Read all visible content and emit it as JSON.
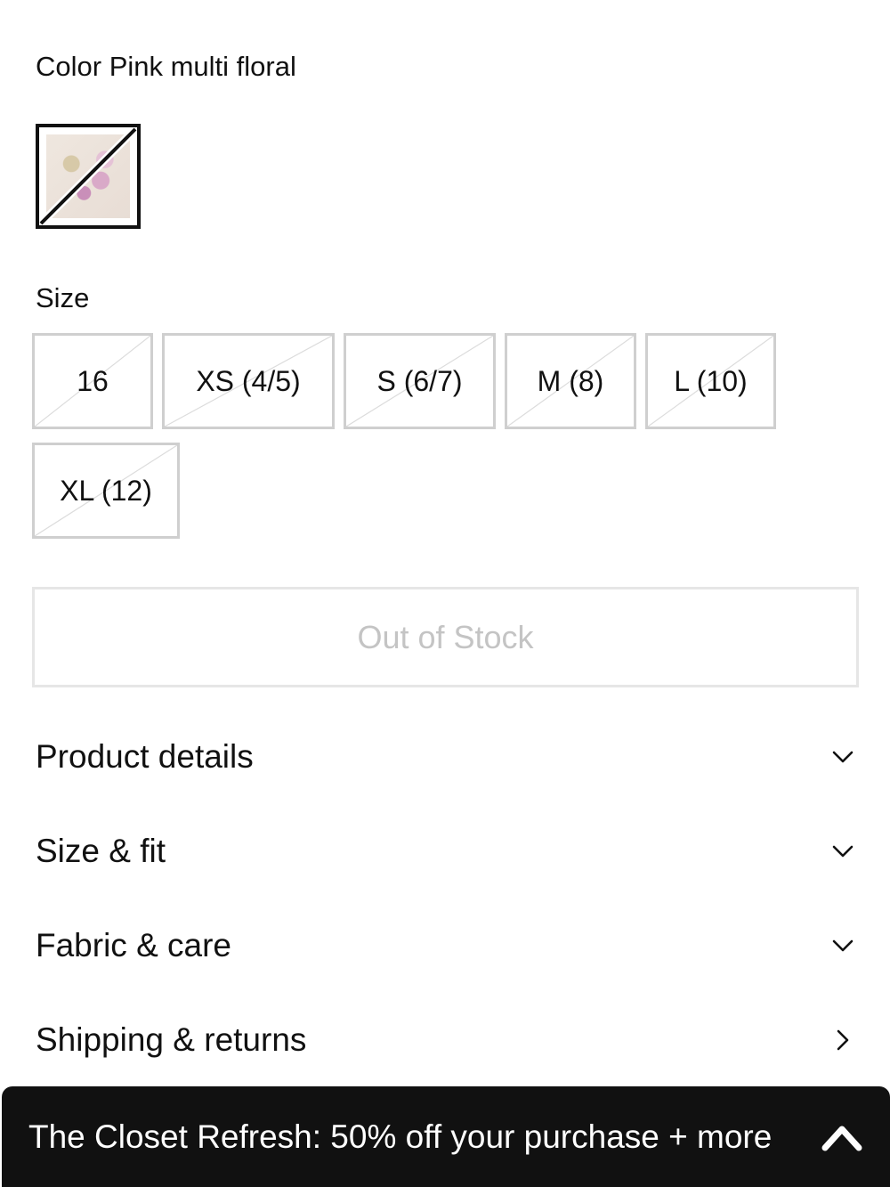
{
  "color": {
    "label": "Color Pink multi floral",
    "selected_swatch": "pink-multi-floral-swatch"
  },
  "size": {
    "label": "Size",
    "options": [
      {
        "label": "16",
        "available": false
      },
      {
        "label": "XS (4/5)",
        "available": false
      },
      {
        "label": "S (6/7)",
        "available": false
      },
      {
        "label": "M (8)",
        "available": false
      },
      {
        "label": "L (10)",
        "available": false
      },
      {
        "label": "XL (12)",
        "available": false
      }
    ]
  },
  "stock_button": {
    "label": "Out of Stock"
  },
  "accordion": [
    {
      "label": "Product details",
      "icon": "chevron-down-icon"
    },
    {
      "label": "Size & fit",
      "icon": "chevron-down-icon"
    },
    {
      "label": "Fabric & care",
      "icon": "chevron-down-icon"
    },
    {
      "label": "Shipping & returns",
      "icon": "chevron-right-icon"
    }
  ],
  "promo": {
    "text": "The Closet Refresh: 50% off your purchase + more",
    "icon": "chevron-up-icon"
  },
  "colors": {
    "text": "#111111",
    "chip_border": "#cfcfcf",
    "disabled_text": "#c4c4c4",
    "banner_bg": "#111111",
    "banner_text": "#ffffff"
  }
}
